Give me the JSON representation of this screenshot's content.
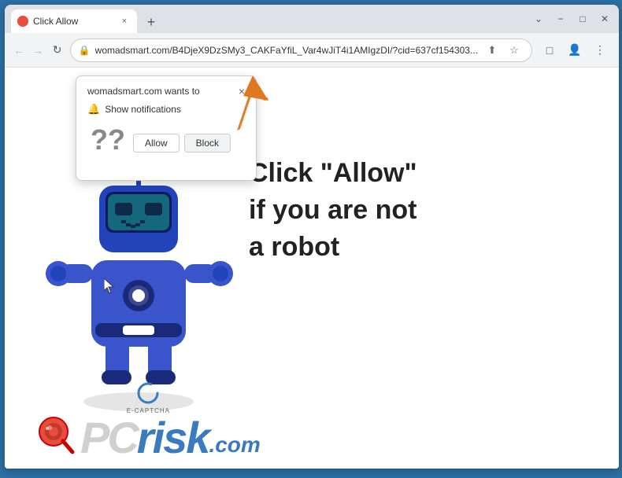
{
  "window": {
    "title": "Click Allow",
    "favicon": "red-circle"
  },
  "titlebar": {
    "tab_label": "Click Allow",
    "new_tab_label": "+",
    "minimize_label": "−",
    "maximize_label": "□",
    "close_label": "✕"
  },
  "addressbar": {
    "back_label": "←",
    "forward_label": "→",
    "refresh_label": "↻",
    "url": "womadsmart.com/B4DjeX9DzSMy3_CAKFaYfiL_Var4wJiT4i1AMIgzDI/?cid=637cf154303...",
    "share_label": "⬆",
    "bookmark_label": "☆",
    "extensions_label": "□",
    "profile_label": "👤",
    "menu_label": "⋮"
  },
  "notification": {
    "title": "womadsmart.com wants to",
    "close_label": "×",
    "show_notifications": "Show notifications",
    "question_marks": "??",
    "allow_label": "Allow",
    "block_label": "Block"
  },
  "page": {
    "click_allow_text": "Click \"Allow\"\nif you are not\na robot",
    "ecaptcha_label": "E-CAPTCHA",
    "pcrisk_text": "PC",
    "pcrisk_risk": "risk",
    "pcrisk_com": ".com"
  },
  "colors": {
    "browser_border": "#2d6fa3",
    "tab_bg": "#dee1e6",
    "active_tab": "#ffffff",
    "url_bar": "#f1f3f4",
    "notification_bg": "#ffffff",
    "allow_btn": "#ffffff",
    "block_btn": "#f1f3f4",
    "orange_arrow": "#e07820",
    "robot_blue": "#3a55cc",
    "page_text": "#222222"
  }
}
